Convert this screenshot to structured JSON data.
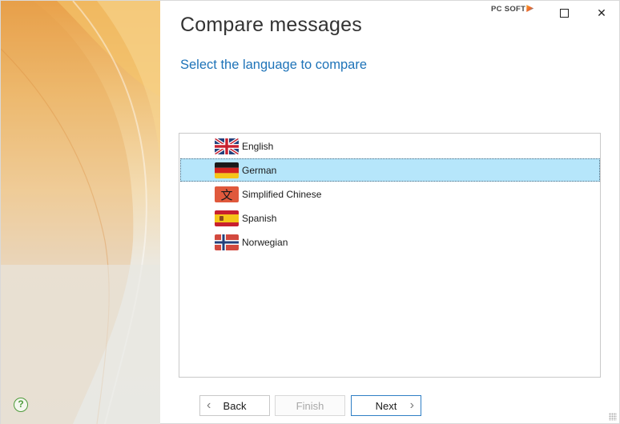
{
  "window": {
    "title": "Compare messages",
    "subtitle": "Select the language to compare",
    "brand": "PC SOFT",
    "help_glyph": "?",
    "maximize_icon": "maximize-icon",
    "close_glyph": "✕"
  },
  "languages": [
    {
      "label": "English",
      "flag_icon": "uk-flag-icon",
      "selected": false
    },
    {
      "label": "German",
      "flag_icon": "germany-flag-icon",
      "selected": true
    },
    {
      "label": "Simplified Chinese",
      "flag_icon": "chinese-character-icon",
      "selected": false
    },
    {
      "label": "Spanish",
      "flag_icon": "spain-flag-icon",
      "selected": false
    },
    {
      "label": "Norwegian",
      "flag_icon": "norway-flag-icon",
      "selected": false
    }
  ],
  "buttons": {
    "back_label": "Back",
    "finish_label": "Finish",
    "next_label": "Next",
    "back_glyph": "‹",
    "next_glyph": "›",
    "finish_enabled": false
  },
  "colors": {
    "accent": "#1e73b8",
    "selection": "#b6e6fb",
    "next_border": "#2f7fc5"
  }
}
